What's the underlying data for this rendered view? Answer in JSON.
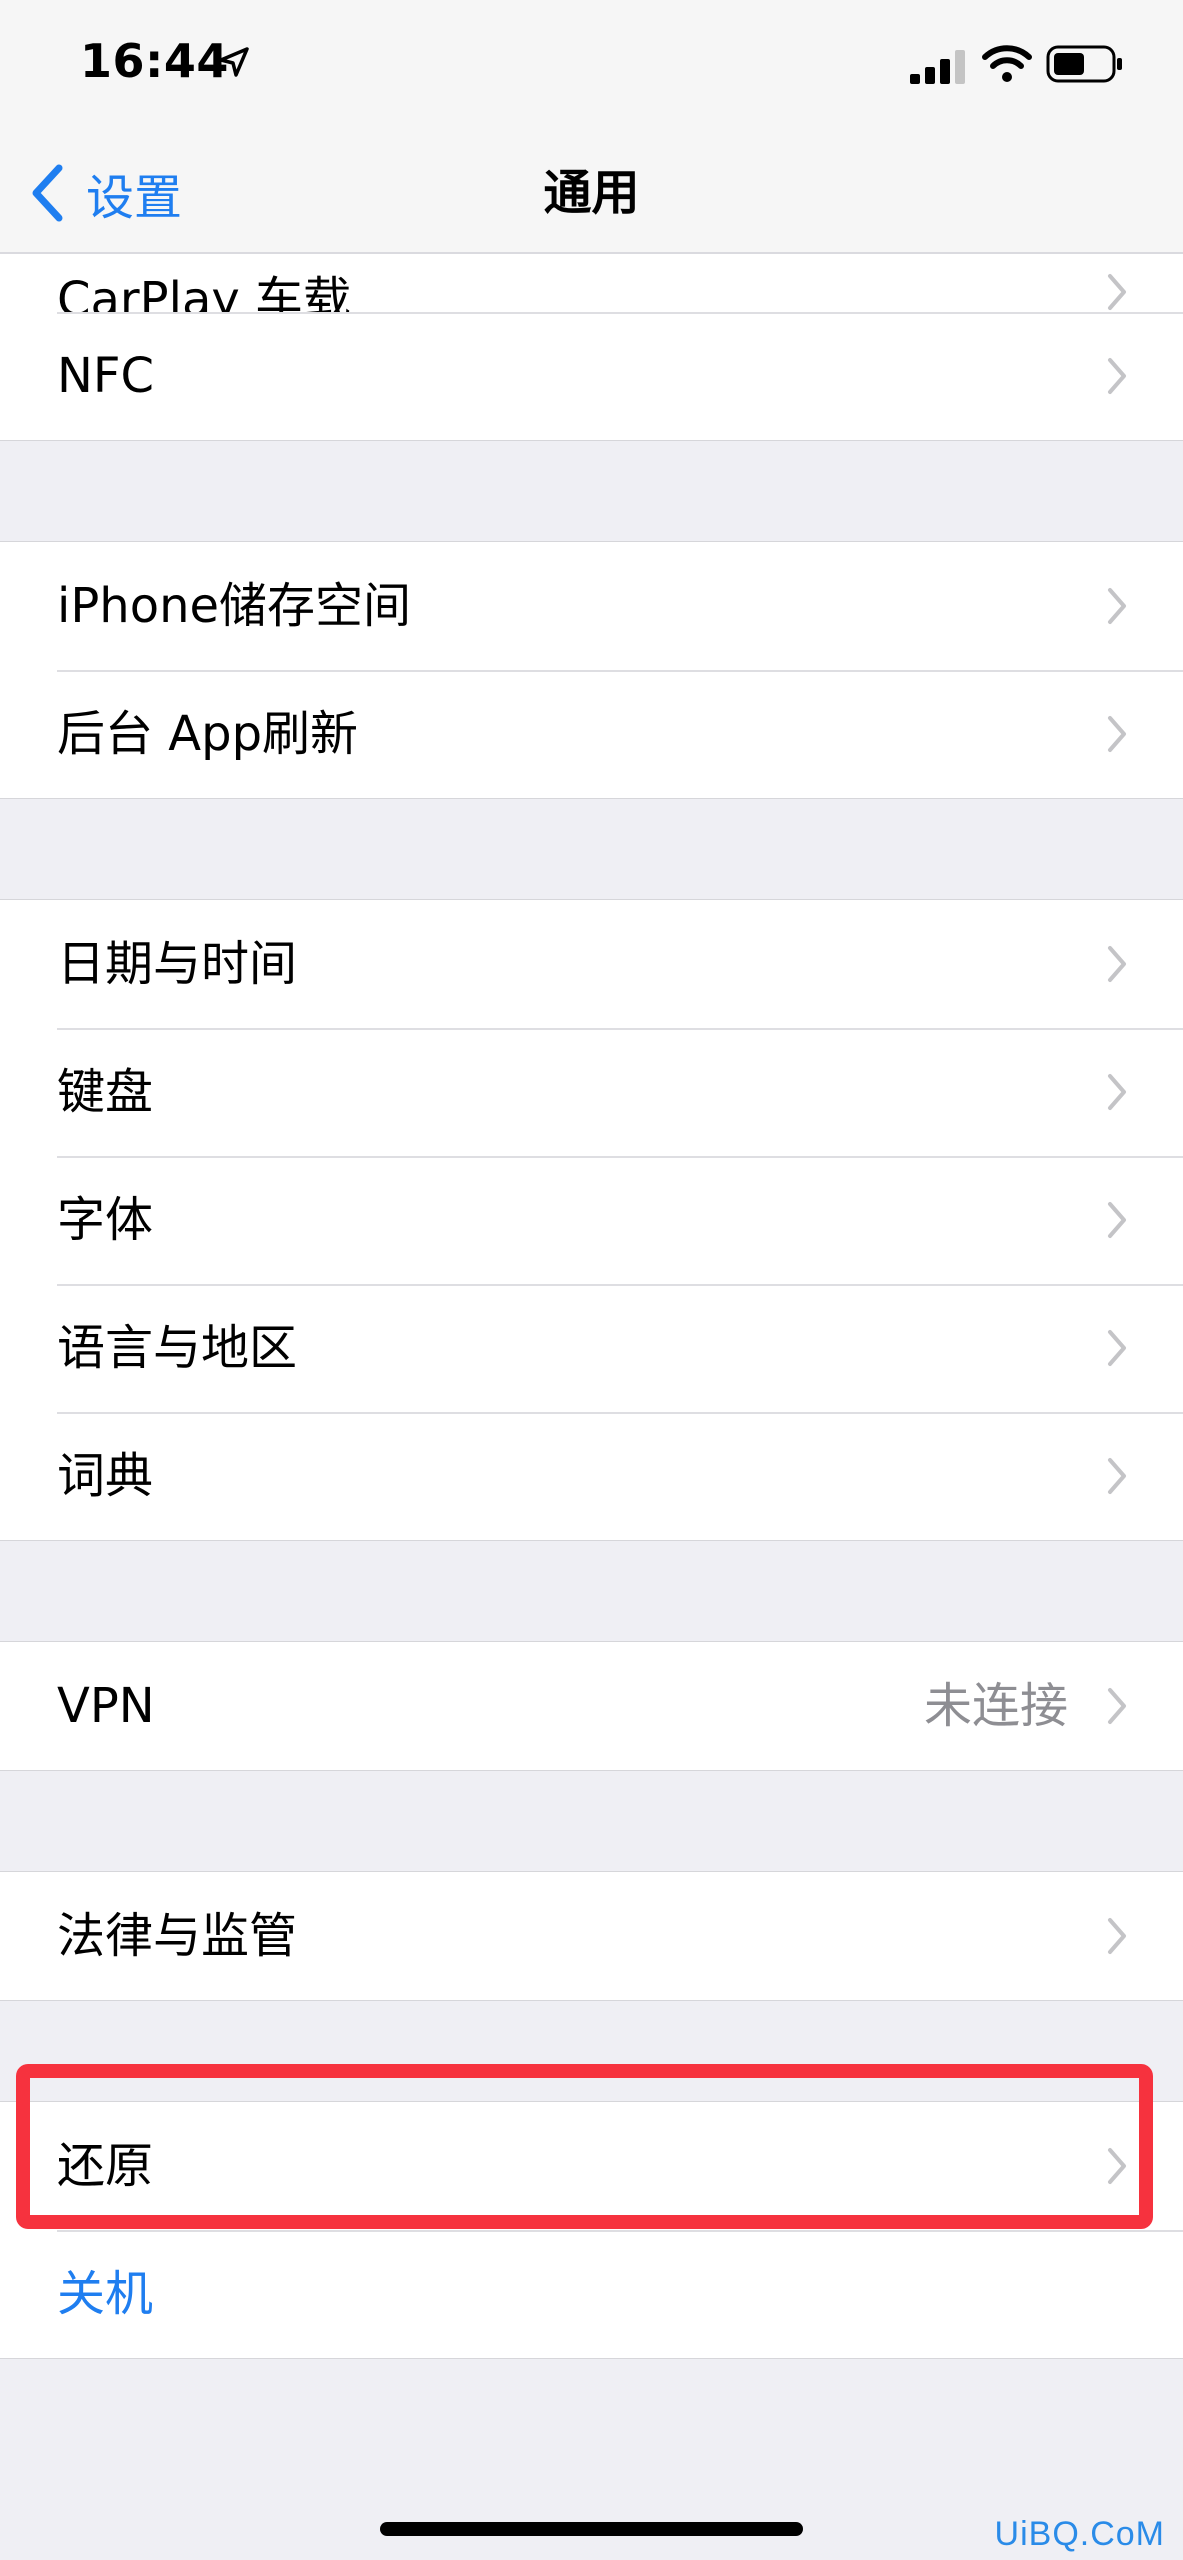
{
  "status": {
    "time": "16:44"
  },
  "nav": {
    "back_label": "设置",
    "title": "通用"
  },
  "groups": [
    {
      "rows": [
        {
          "label": "CarPlay 车载"
        },
        {
          "label": "NFC"
        }
      ]
    },
    {
      "rows": [
        {
          "label": "iPhone储存空间"
        },
        {
          "label": "后台 App刷新"
        }
      ]
    },
    {
      "rows": [
        {
          "label": "日期与时间"
        },
        {
          "label": "键盘"
        },
        {
          "label": "字体"
        },
        {
          "label": "语言与地区"
        },
        {
          "label": "词典"
        }
      ]
    },
    {
      "rows": [
        {
          "label": "VPN",
          "value": "未连接"
        }
      ]
    },
    {
      "rows": [
        {
          "label": "法律与监管"
        }
      ]
    },
    {
      "rows": [
        {
          "label": "还原"
        },
        {
          "label": "关机"
        }
      ]
    }
  ],
  "watermark": "UiBQ.CoM",
  "colors": {
    "accent": "#1f7ef0",
    "highlight": "#f6323e",
    "background": "#efeff4"
  }
}
